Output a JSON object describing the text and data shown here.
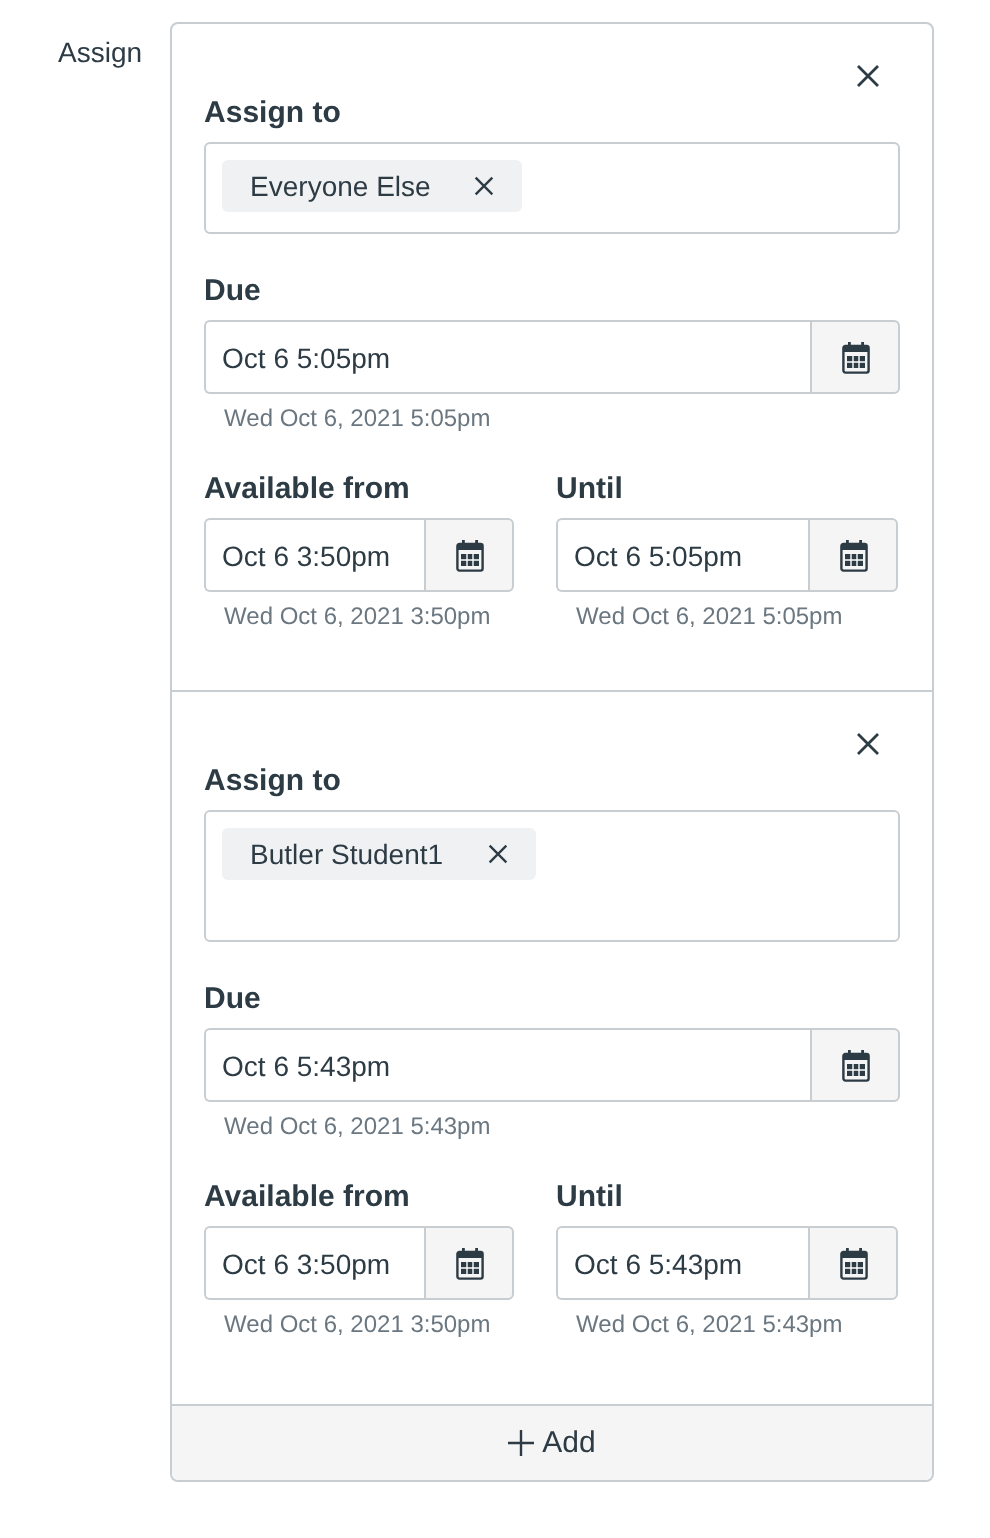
{
  "label": "Assign",
  "overrides": [
    {
      "assign_to": {
        "label": "Assign to",
        "tags": [
          "Everyone Else"
        ]
      },
      "due": {
        "label": "Due",
        "value": "Oct 6 5:05pm",
        "hint": "Wed Oct 6, 2021 5:05pm"
      },
      "available_from": {
        "label": "Available from",
        "value": "Oct 6 3:50pm",
        "hint": "Wed Oct 6, 2021 3:50pm"
      },
      "until": {
        "label": "Until",
        "value": "Oct 6 5:05pm",
        "hint": "Wed Oct 6, 2021 5:05pm"
      }
    },
    {
      "assign_to": {
        "label": "Assign to",
        "tags": [
          "Butler Student1"
        ]
      },
      "due": {
        "label": "Due",
        "value": "Oct 6 5:43pm",
        "hint": "Wed Oct 6, 2021 5:43pm"
      },
      "available_from": {
        "label": "Available from",
        "value": "Oct 6 3:50pm",
        "hint": "Wed Oct 6, 2021 3:50pm"
      },
      "until": {
        "label": "Until",
        "value": "Oct 6 5:43pm",
        "hint": "Wed Oct 6, 2021 5:43pm"
      }
    }
  ],
  "add_button": {
    "label": "Add"
  }
}
